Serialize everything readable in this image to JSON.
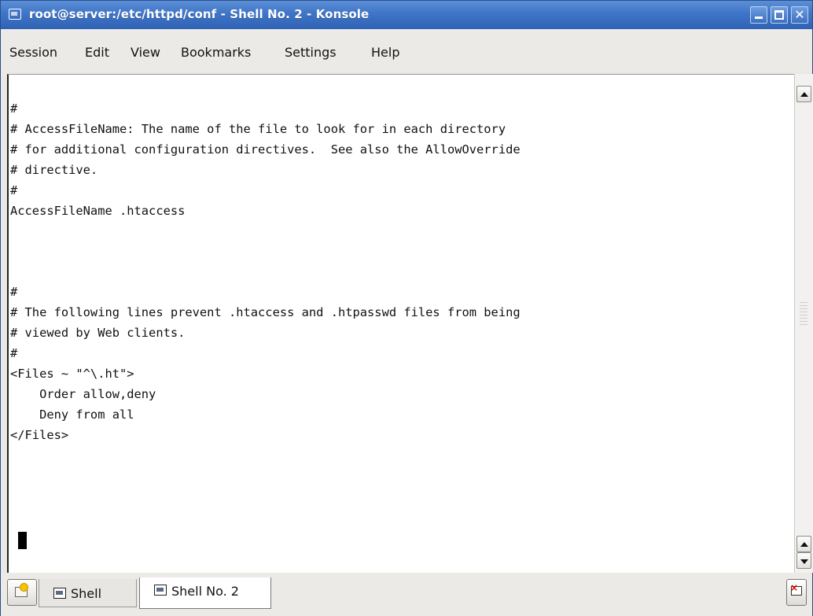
{
  "window": {
    "title": "root@server:/etc/httpd/conf - Shell No. 2 - Konsole",
    "controls": {
      "minimize": "",
      "maximize": "",
      "close": "✕"
    }
  },
  "menu": {
    "session": "Session",
    "edit": "Edit",
    "view": "View",
    "bookmarks": "Bookmarks",
    "settings": "Settings",
    "help": "Help"
  },
  "terminal": {
    "content": "#\n# AccessFileName: The name of the file to look for in each directory\n# for additional configuration directives.  See also the AllowOverride\n# directive.\n#\nAccessFileName .htaccess\n\n\n\n#\n# The following lines prevent .htaccess and .htpasswd files from being\n# viewed by Web clients.\n#\n<Files ~ \"^\\.ht\">\n    Order allow,deny\n    Deny from all\n</Files>"
  },
  "tabs": [
    {
      "label": "Shell",
      "active": false
    },
    {
      "label": "Shell No. 2",
      "active": true
    }
  ],
  "icons": {
    "app": "konsole-icon",
    "new_session": "new-session-icon",
    "tab": "terminal-icon",
    "close_session": "close-session-icon"
  }
}
